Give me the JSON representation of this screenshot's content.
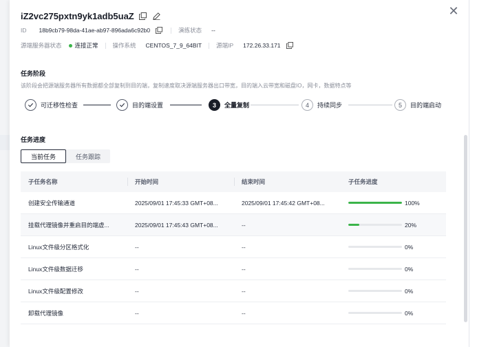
{
  "header": {
    "title": "iZ2vc275pxtn9yk1adb5uaZ",
    "id_label": "ID",
    "id_value": "18b9cb79-98da-41ae-ab97-896ada6c92b0",
    "drill_label": "演练状态",
    "drill_value": "--",
    "source_label": "源端服务器状态",
    "source_status": "连接正常",
    "os_label": "操作系统",
    "os_value": "CENTOS_7_9_64BIT",
    "ip_label": "源端IP",
    "ip_value": "172.26.33.171"
  },
  "stage": {
    "title": "任务阶段",
    "desc": "该阶段会把源端服务器所有数据都全部复制到目的端，复制速度取决源端服务器出口带宽，目的端入云带宽和磁盘IO，网卡，数据特点等",
    "steps": [
      {
        "num": "",
        "label": "可迁移性检查",
        "state": "done"
      },
      {
        "num": "",
        "label": "目的端设置",
        "state": "done"
      },
      {
        "num": "3",
        "label": "全量复制",
        "state": "active"
      },
      {
        "num": "4",
        "label": "持续同步",
        "state": "pending"
      },
      {
        "num": "5",
        "label": "目的端启动",
        "state": "pending"
      }
    ]
  },
  "progress": {
    "title": "任务进度",
    "tabs": [
      "当前任务",
      "任务跟踪"
    ],
    "columns": [
      "子任务名称",
      "开始时间",
      "结束时间",
      "子任务进度"
    ],
    "rows": [
      {
        "name": "创建安全传输通道",
        "start": "2025/09/01 17:45:33 GMT+08...",
        "end": "2025/09/01 17:45:42 GMT+08...",
        "progress": 100,
        "pct": "100%"
      },
      {
        "name": "挂载代理镜像并重启目的端虚...",
        "start": "2025/09/01 17:45:43 GMT+08...",
        "end": "--",
        "progress": 20,
        "pct": "20%"
      },
      {
        "name": "Linux文件级分区格式化",
        "start": "--",
        "end": "--",
        "progress": 0,
        "pct": "0%"
      },
      {
        "name": "Linux文件级数据迁移",
        "start": "--",
        "end": "--",
        "progress": 0,
        "pct": "0%"
      },
      {
        "name": "Linux文件级配置修改",
        "start": "--",
        "end": "--",
        "progress": 0,
        "pct": "0%"
      },
      {
        "name": "卸载代理镜像",
        "start": "--",
        "end": "--",
        "progress": 0,
        "pct": "0%"
      }
    ]
  },
  "colors": {
    "success": "#3bb44a",
    "text": "#252b3a",
    "muted": "#8a8e99"
  }
}
